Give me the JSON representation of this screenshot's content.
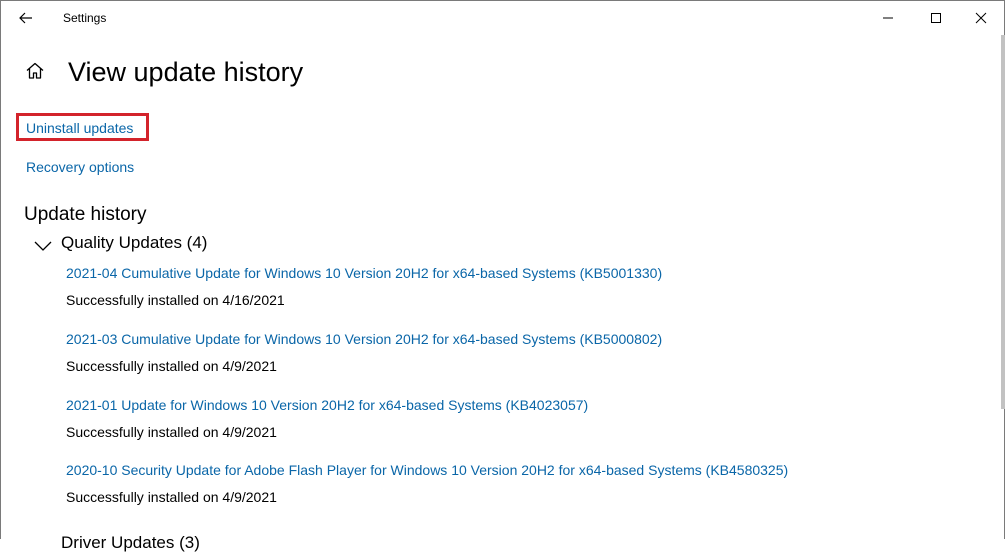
{
  "window": {
    "title": "Settings"
  },
  "page": {
    "title": "View update history"
  },
  "links": {
    "uninstall": "Uninstall updates",
    "recovery": "Recovery options"
  },
  "update_history": {
    "heading": "Update history",
    "groups": [
      {
        "label": "Quality Updates (4)",
        "expanded": true,
        "items": [
          {
            "title": "2021-04 Cumulative Update for Windows 10 Version 20H2 for x64-based Systems (KB5001330)",
            "status": "Successfully installed on 4/16/2021"
          },
          {
            "title": "2021-03 Cumulative Update for Windows 10 Version 20H2 for x64-based Systems (KB5000802)",
            "status": "Successfully installed on 4/9/2021"
          },
          {
            "title": "2021-01 Update for Windows 10 Version 20H2 for x64-based Systems (KB4023057)",
            "status": "Successfully installed on 4/9/2021"
          },
          {
            "title": "2020-10 Security Update for Adobe Flash Player for Windows 10 Version 20H2 for x64-based Systems (KB4580325)",
            "status": "Successfully installed on 4/9/2021"
          }
        ]
      },
      {
        "label": "Driver Updates (3)",
        "expanded": false
      }
    ]
  },
  "colors": {
    "link": "#0a66a8",
    "highlight_box": "#d3232b"
  },
  "icons": {
    "back": "back-arrow-icon",
    "home": "home-icon",
    "chevron": "chevron-down-icon"
  }
}
